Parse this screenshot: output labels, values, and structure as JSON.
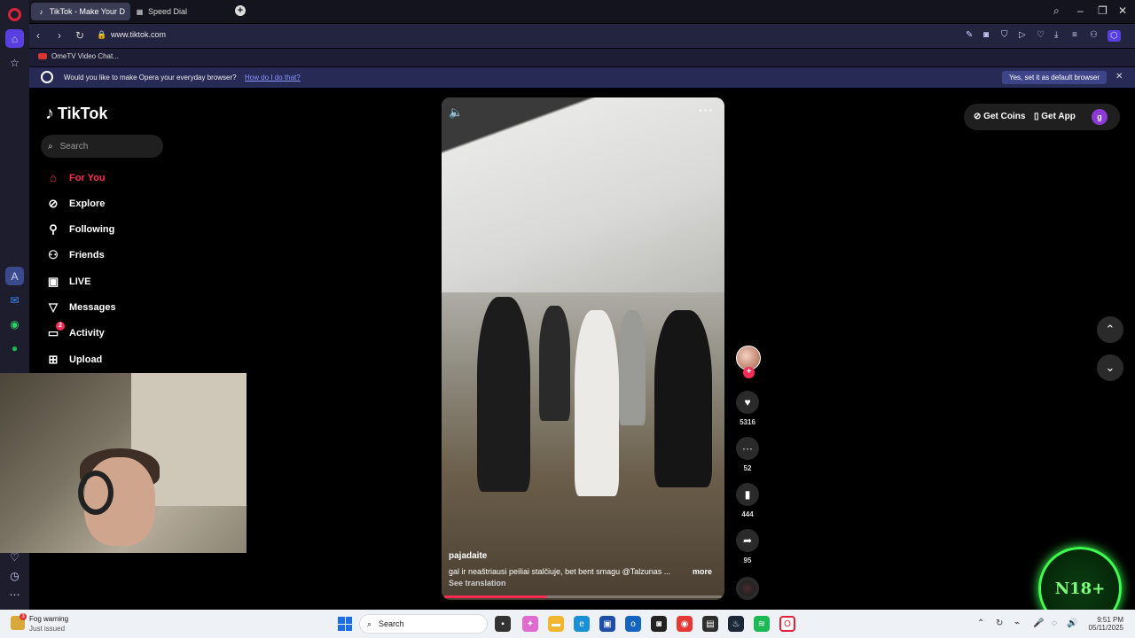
{
  "browser": {
    "tabs": [
      {
        "label": "TikTok - Make Your D",
        "active": true
      },
      {
        "label": "Speed Dial",
        "active": false
      }
    ],
    "url": "www.tiktok.com",
    "bookmark": "OmeTV Video Chat...",
    "banner": {
      "question": "Would you like to make Opera your everyday browser?",
      "how_link": "How do I do that?",
      "yes_button": "Yes, set it as default browser"
    },
    "accent": "#5a3fe0"
  },
  "tiktok": {
    "brand": "TikTok",
    "search_placeholder": "Search",
    "nav": [
      {
        "label": "For You",
        "icon": "home-icon",
        "active": true
      },
      {
        "label": "Explore",
        "icon": "compass-icon"
      },
      {
        "label": "Following",
        "icon": "following-icon"
      },
      {
        "label": "Friends",
        "icon": "friends-icon"
      },
      {
        "label": "LIVE",
        "icon": "live-icon"
      },
      {
        "label": "Messages",
        "icon": "messages-icon"
      },
      {
        "label": "Activity",
        "icon": "activity-icon",
        "badge": "2"
      },
      {
        "label": "Upload",
        "icon": "upload-icon"
      }
    ],
    "top": {
      "coins": "Get Coins",
      "app": "Get App",
      "profile_initial": "g"
    },
    "video": {
      "author": "pajadaite",
      "caption": "gal ir neaštriausi peiliai stalčiuje, bet bent smagu @Talzunas ...",
      "more": "more",
      "see_translation": "See translation",
      "progress": 0.37
    },
    "actions": {
      "likes": "5316",
      "comments": "52",
      "saves": "444",
      "shares": "95"
    },
    "accent": "#fe2c55"
  },
  "overlay": {
    "badge": "N18+"
  },
  "taskbar": {
    "weather_title": "Fog warning",
    "weather_sub": "Just issued",
    "weather_badge": "3",
    "search": "Search",
    "time": "9:51 PM",
    "date": "05/11/2025"
  }
}
